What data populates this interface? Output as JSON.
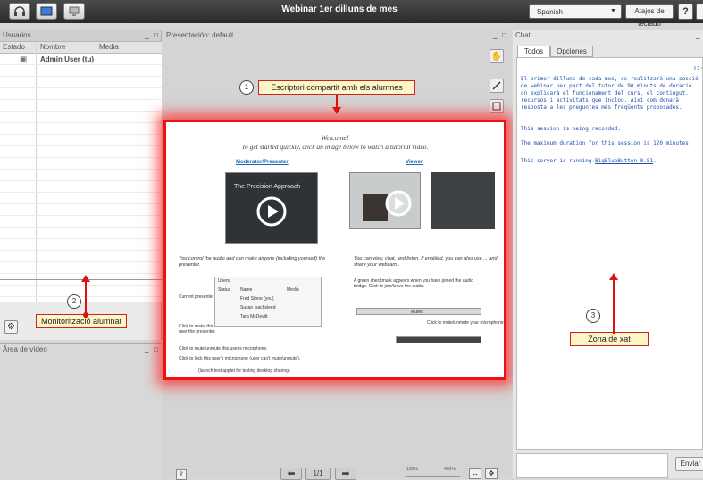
{
  "app": {
    "title": "Webinar 1er dilluns de mes"
  },
  "topbar": {
    "language": "Spanish",
    "shortcuts_label": "Atajos de teclado",
    "help_label": "?"
  },
  "users": {
    "title": "Usuarios",
    "columns": [
      "Estado",
      "Nombre",
      "Media"
    ],
    "rows": [
      {
        "name": "Admin User (tu)"
      }
    ]
  },
  "video": {
    "title": "Área de vídeo"
  },
  "presentation": {
    "title": "Presentación: default",
    "page_label": "1/1",
    "zoom_labels": [
      "100%",
      "400%"
    ],
    "slide": {
      "welcome": "Welcome!",
      "subtitle": "To get started quickly, click an image below to watch a tutorial video.",
      "moderator_link": "Moderator/Presenter",
      "viewer_link": "Viewer",
      "video_caption": "The Precision Approach",
      "moderator_text": "You control the audio and can make anyone (including yourself) the presenter.",
      "viewer_text": "You can view, chat, and listen.  If enabled, you can also use ... and share your webcam..",
      "mini_title": "Users",
      "mini_cols": [
        "Status",
        "Name",
        "Media"
      ],
      "mini_rows": [
        "Fred Stone (you)",
        "Susan Isachsleed",
        "Tara McDevitt"
      ],
      "current_presenter": "Current presenter",
      "click_make_presenter": "Click to make this user the presenter.",
      "click_mute": "Click to mute/unmute this user's microphone.",
      "click_lock": "Click to lock this user's microphone (user can't mute/unmute).",
      "launch_text": "(launch test applet for testing desktop sharing)",
      "checkmark_text": "A green checkmark appears when you have joined the audio bridge.  Click to join/leave the audio.",
      "mute_text": "Click to mute/unmute your microphone.",
      "muted_label": "Muted"
    }
  },
  "chat": {
    "title": "Chat",
    "tabs": [
      "Todos",
      "Opciones"
    ],
    "time": "12:",
    "messages": [
      "El primer dilluns de cada mes, es realitzarà una sessió de webinar per part del tutor de 90 minuts de duració on explicarà el funcionament del curs, el contingut, recursos i activitats que inclou. Així com donarà resposta a les preguntes més freqüents proposades.",
      "This session is being recorded.",
      "The maximum duration for this session is 120 minutes."
    ],
    "server_prefix": "This server is running ",
    "server_link": "BigBlueButton 0.81",
    "server_suffix": ".",
    "send_label": "Enviar"
  },
  "annotations": {
    "a1_num": "1",
    "a1_text": "Escriptori compartit amb els alumnes",
    "a2_num": "2",
    "a2_text": "Monitorització alumnat",
    "a3_num": "3",
    "a3_text": "Zona de xat"
  },
  "colors": {
    "highlight": "#ee1111",
    "chat_text": "#1f4fb0",
    "callout_bg": "#fff6c8"
  }
}
